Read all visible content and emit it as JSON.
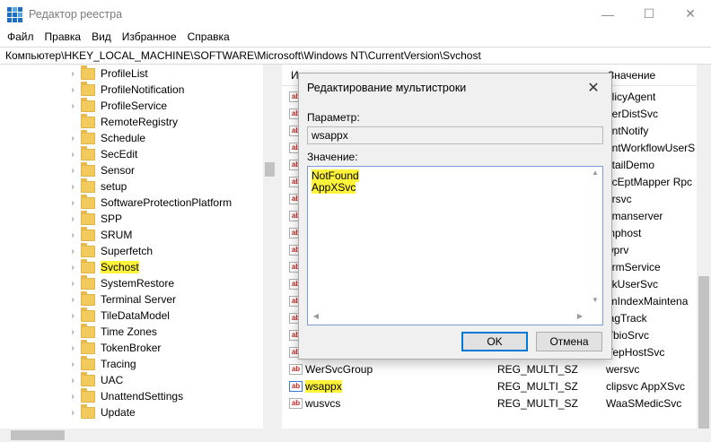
{
  "window": {
    "title": "Редактор реестра",
    "controls": {
      "minimize": "—",
      "maximize": "☐",
      "close": "✕"
    }
  },
  "menu": [
    "Файл",
    "Правка",
    "Вид",
    "Избранное",
    "Справка"
  ],
  "address": "Компьютер\\HKEY_LOCAL_MACHINE\\SOFTWARE\\Microsoft\\Windows NT\\CurrentVersion\\Svchost",
  "tree": [
    {
      "label": "ProfileList",
      "expander": "›"
    },
    {
      "label": "ProfileNotification",
      "expander": "›"
    },
    {
      "label": "ProfileService",
      "expander": "›"
    },
    {
      "label": "RemoteRegistry",
      "expander": ""
    },
    {
      "label": "Schedule",
      "expander": "›"
    },
    {
      "label": "SecEdit",
      "expander": "›"
    },
    {
      "label": "Sensor",
      "expander": "›"
    },
    {
      "label": "setup",
      "expander": "›"
    },
    {
      "label": "SoftwareProtectionPlatform",
      "expander": "›"
    },
    {
      "label": "SPP",
      "expander": "›"
    },
    {
      "label": "SRUM",
      "expander": "›"
    },
    {
      "label": "Superfetch",
      "expander": "›"
    },
    {
      "label": "Svchost",
      "expander": "›",
      "selected": true
    },
    {
      "label": "SystemRestore",
      "expander": "›"
    },
    {
      "label": "Terminal Server",
      "expander": "›"
    },
    {
      "label": "TileDataModel",
      "expander": "›"
    },
    {
      "label": "Time Zones",
      "expander": "›"
    },
    {
      "label": "TokenBroker",
      "expander": "›"
    },
    {
      "label": "Tracing",
      "expander": "›"
    },
    {
      "label": "UAC",
      "expander": "›"
    },
    {
      "label": "UnattendSettings",
      "expander": "›"
    },
    {
      "label": "Update",
      "expander": "›"
    }
  ],
  "list_header": {
    "name_col": "И",
    "data_col": "Значение"
  },
  "list_partial": [
    "olicyAgent",
    "eerDistSvc",
    "rintNotify",
    "rintWorkflowUserS",
    "etailDemo",
    "pcEptMapper Rpc",
    "drsvc",
    "nmanserver",
    "mphost",
    "wprv",
    "ermService",
    "dkUserSvc",
    "imIndexMaintena",
    "iagTrack",
    "VbioSrvc",
    "VepHostSvc"
  ],
  "list_rows": [
    {
      "icon": "ab",
      "name": "WerSvcGroup",
      "type": "REG_MULTI_SZ",
      "data": "wersvc"
    },
    {
      "icon": "ab",
      "name": "wsappx",
      "type": "REG_MULTI_SZ",
      "data": "clipsvc AppXSvc",
      "selected": true
    },
    {
      "icon": "ab",
      "name": "wusvcs",
      "type": "REG_MULTI_SZ",
      "data": "WaaSMedicSvc"
    }
  ],
  "dialog": {
    "title": "Редактирование мультистроки",
    "param_label": "Параметр:",
    "param_value": "wsappx",
    "value_label": "Значение:",
    "value_lines": [
      "NotFound",
      "AppXSvc"
    ],
    "ok": "OK",
    "cancel": "Отмена",
    "close": "✕"
  }
}
